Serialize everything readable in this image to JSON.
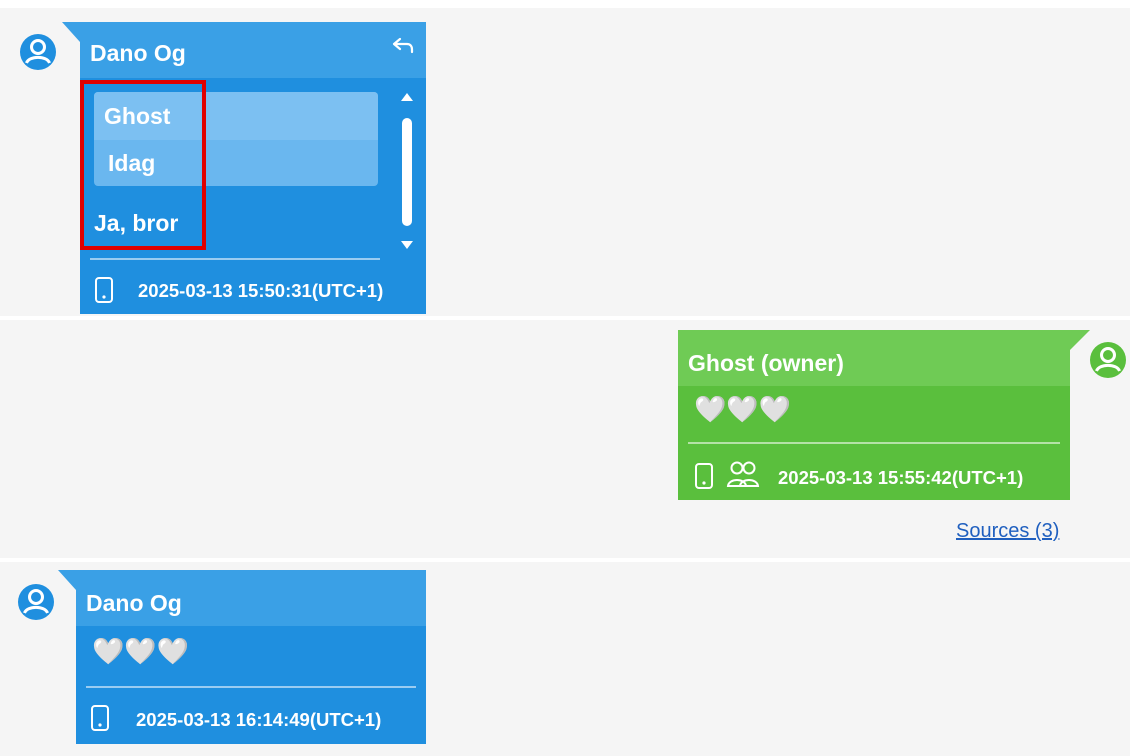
{
  "messages": [
    {
      "sender": "Dano Og",
      "quote": {
        "sender": "Ghost",
        "text": "Idag"
      },
      "text": "Ja, bror",
      "timestamp": "2025-03-13 15:50:31(UTC+1)",
      "icons": [
        "user-avatar-icon",
        "reply-icon",
        "phone-icon"
      ]
    },
    {
      "sender": "Ghost (owner)",
      "text": "🤍🤍🤍",
      "timestamp": "2025-03-13 15:55:42(UTC+1)",
      "icons": [
        "user-avatar-icon",
        "phone-icon",
        "group-icon"
      ]
    },
    {
      "sender": "Dano Og",
      "text": "🤍🤍🤍",
      "timestamp": "2025-03-13 16:14:49(UTC+1)",
      "icons": [
        "user-avatar-icon",
        "phone-icon"
      ]
    }
  ],
  "sources_link": "Sources (3)",
  "colors": {
    "incoming_bubble": "#1f8fdf",
    "incoming_header": "#3aa0e6",
    "outgoing_bubble": "#5abf3d",
    "outgoing_header": "#6fcb55",
    "highlight_box": "#e00000",
    "link": "#1f5fbf"
  }
}
